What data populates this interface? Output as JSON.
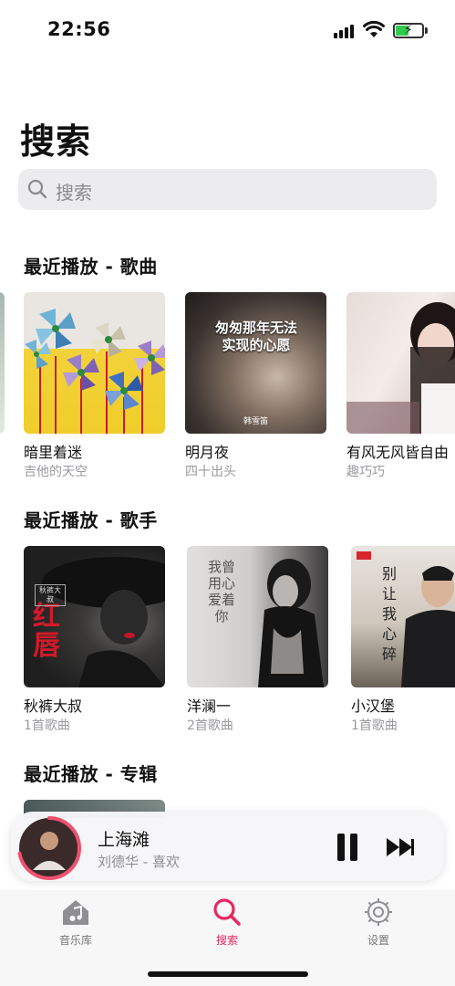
{
  "status": {
    "time": "22:56"
  },
  "page": {
    "title": "搜索"
  },
  "search": {
    "placeholder": "搜索"
  },
  "sections": {
    "recent_songs": "最近播放 - 歌曲",
    "recent_artists": "最近播放 - 歌手",
    "recent_albums": "最近播放 - 专辑"
  },
  "songs": [
    {
      "title": "暗里着迷",
      "artist": "吉他的天空"
    },
    {
      "title": "明月夜",
      "artist": "四十出头",
      "art_text": "匆匆那年无法实现的心愿",
      "art_caption": "韩雪笛"
    },
    {
      "title": "有风无风皆自由",
      "artist": "趣巧巧"
    }
  ],
  "artists": [
    {
      "name": "秋裤大叔",
      "count": "1首歌曲",
      "art_text_big": "红唇",
      "art_text_small": "秋裤大叔"
    },
    {
      "name": "洋澜一",
      "count": "2首歌曲",
      "art_text": "我曾用心爱着你"
    },
    {
      "name": "小汉堡",
      "count": "1首歌曲",
      "art_text": "别让我心碎"
    }
  ],
  "player": {
    "title": "上海滩",
    "artist": "刘德华 - 喜欢",
    "progress": 0.72
  },
  "tabs": [
    {
      "label": "音乐库",
      "icon": "music-library-icon"
    },
    {
      "label": "搜索",
      "icon": "search-icon",
      "active": true
    },
    {
      "label": "设置",
      "icon": "settings-icon"
    }
  ],
  "colors": {
    "accent": "#e8265f",
    "progress": "#f0506e"
  }
}
